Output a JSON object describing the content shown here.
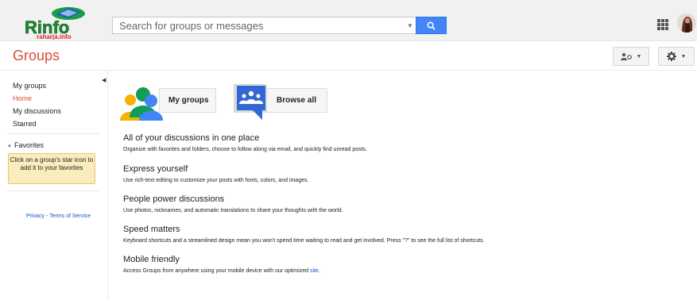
{
  "header": {
    "logo_text": "Rinfo",
    "logo_subtext": "raharja.info",
    "search_placeholder": "Search for groups or messages"
  },
  "page": {
    "title": "Groups"
  },
  "sidebar": {
    "items": [
      {
        "label": "My groups"
      },
      {
        "label": "Home"
      },
      {
        "label": "My discussions"
      },
      {
        "label": "Starred"
      }
    ],
    "favorites_label": "Favorites",
    "favorites_hint": "Click on a group's star icon to add it to your favorites",
    "privacy_label": "Privacy",
    "privacy_sep": " - ",
    "terms_label": "Terms of Service"
  },
  "main": {
    "my_groups_label": "My groups",
    "browse_all_label": "Browse all",
    "features": [
      {
        "title": "All of your discussions in one place",
        "desc": "Organize with favorites and folders, choose to follow along via email, and quickly find unread posts."
      },
      {
        "title": "Express yourself",
        "desc": "Use rich-text editing to customize your posts with fonts, colors, and images."
      },
      {
        "title": "People power discussions",
        "desc": "Use photos, nicknames, and automatic translations to share your thoughts with the world."
      },
      {
        "title": "Speed matters",
        "desc": "Keyboard shortcuts and a streamlined design mean you won't spend time waiting to read and get involved. Press \"?\" to see the full list of shortcuts."
      },
      {
        "title": "Mobile friendly",
        "desc": "Access Groups from anywhere using your mobile device with our optimized",
        "link": "site",
        "tail": "."
      }
    ]
  },
  "colors": {
    "accent_red": "#dd4b39",
    "search_blue": "#4285f4",
    "link_blue": "#1155cc",
    "hint_yellow": "#f9edbe"
  }
}
